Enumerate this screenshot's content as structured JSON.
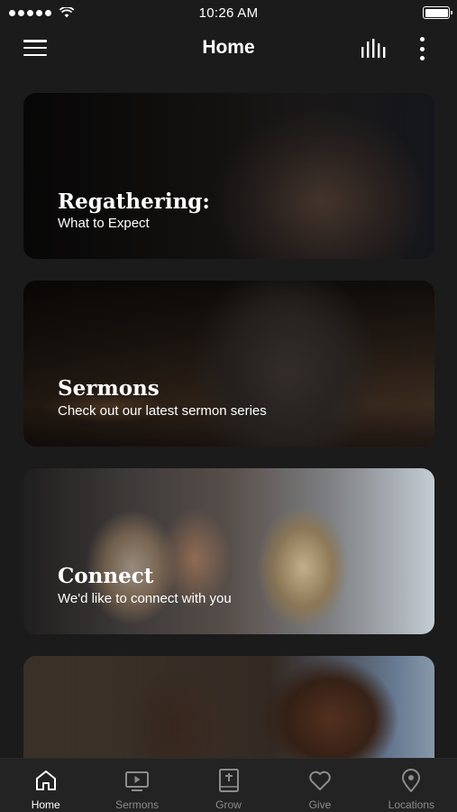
{
  "status_bar": {
    "time": "10:26 AM"
  },
  "header": {
    "title": "Home",
    "menu_icon": "hamburger-menu-icon",
    "audio_icon": "audio-bars-icon",
    "more_icon": "more-vertical-icon"
  },
  "cards": [
    {
      "title": "Regathering:",
      "subtitle": "What to Expect"
    },
    {
      "title": "Sermons",
      "subtitle": "Check out our latest sermon series"
    },
    {
      "title": "Connect",
      "subtitle": "We'd like to connect with you"
    }
  ],
  "tabs": [
    {
      "label": "Home",
      "icon": "home-icon",
      "active": true
    },
    {
      "label": "Sermons",
      "icon": "play-screen-icon",
      "active": false
    },
    {
      "label": "Grow",
      "icon": "bible-icon",
      "active": false
    },
    {
      "label": "Give",
      "icon": "heart-icon",
      "active": false
    },
    {
      "label": "Locations",
      "icon": "map-pin-icon",
      "active": false
    }
  ],
  "colors": {
    "background": "#1b1b1b",
    "tab_bar": "#232323",
    "active_tab": "#ffffff",
    "inactive_tab": "#8c8c8c"
  }
}
